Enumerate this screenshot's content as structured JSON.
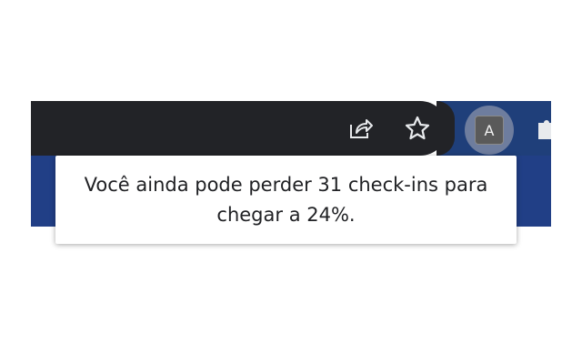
{
  "toolbar": {
    "share_icon": "share-icon",
    "bookmark_icon": "star-icon",
    "extensions_icon": "puzzle-icon"
  },
  "profile": {
    "initial": "A"
  },
  "tooltip": {
    "text": "Você ainda pode perder 31 check-ins para chegar a 24%."
  },
  "colors": {
    "toolbar_dark": "#222327",
    "page_blue": "#213f86",
    "tooltip_bg": "#ffffff",
    "tooltip_text": "#202124"
  }
}
